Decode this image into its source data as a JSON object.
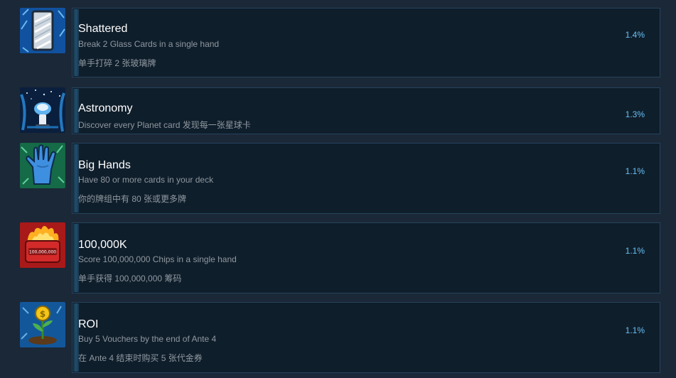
{
  "achievements": [
    {
      "title": "Shattered",
      "description": "Break 2 Glass Cards in a single hand",
      "description_zh": "单手打碎 2 张玻璃牌",
      "percent": "1.4%",
      "icon": "glass-card-icon"
    },
    {
      "title": "Astronomy",
      "description": "Discover every Planet card 发现每一张星球卡",
      "description_zh": "",
      "percent": "1.3%",
      "icon": "astronomy-icon"
    },
    {
      "title": "Big Hands",
      "description": "Have 80 or more cards in your deck",
      "description_zh": "你的牌组中有 80 张或更多牌",
      "percent": "1.1%",
      "icon": "hand-icon"
    },
    {
      "title": "100,000K",
      "description": "Score 100,000,000 Chips in a single hand",
      "description_zh": "单手获得 100,000,000 筹码",
      "percent": "1.1%",
      "icon": "chips-fire-icon",
      "icon_text": "100,000,000"
    },
    {
      "title": "ROI",
      "description": "Buy 5 Vouchers by the end of Ante 4",
      "description_zh": "在 Ante 4 结束时购买 5 张代金券",
      "percent": "1.1%",
      "icon": "money-plant-icon"
    }
  ]
}
